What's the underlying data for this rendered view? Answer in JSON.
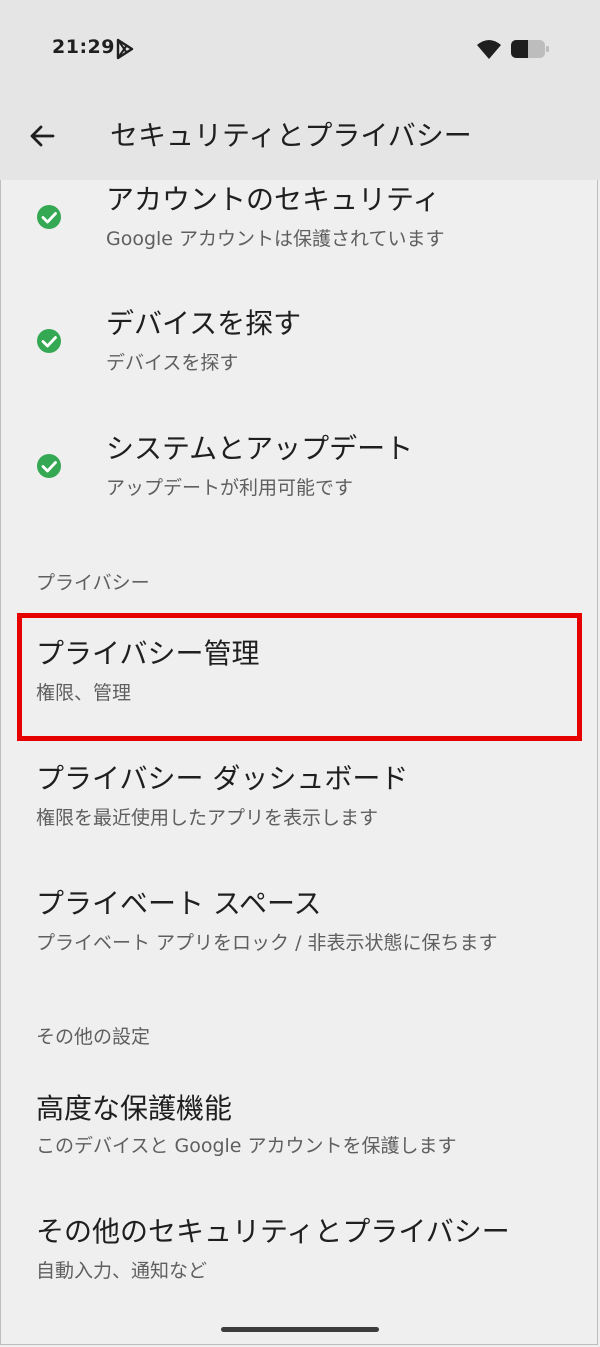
{
  "status_bar": {
    "time": "21:29"
  },
  "app_bar": {
    "title": "セキュリティとプライバシー"
  },
  "security_items": [
    {
      "title": "アカウントのセキュリティ",
      "subtitle": "Google アカウントは保護されています"
    },
    {
      "title": "デバイスを探す",
      "subtitle": "デバイスを探す"
    },
    {
      "title": "システムとアップデート",
      "subtitle": "アップデートが利用可能です"
    }
  ],
  "privacy_section": {
    "header": "プライバシー",
    "items": [
      {
        "title": "プライバシー管理",
        "subtitle": "権限、管理"
      },
      {
        "title": "プライバシー ダッシュボード",
        "subtitle": "権限を最近使用したアプリを表示します"
      },
      {
        "title": "プライベート スペース",
        "subtitle": "プライベート アプリをロック / 非表示状態に保ちます"
      }
    ]
  },
  "other_section": {
    "header": "その他の設定",
    "items": [
      {
        "title": "高度な保護機能",
        "subtitle": "このデバイスと Google アカウントを保護します"
      },
      {
        "title": "その他のセキュリティとプライバシー",
        "subtitle": "自動入力、通知など"
      }
    ]
  },
  "colors": {
    "check_green": "#34a853",
    "highlight_red": "#e60000"
  },
  "icons": [
    "play-store-icon",
    "wifi-icon",
    "battery-icon",
    "back-arrow-icon",
    "check-circle-icon"
  ]
}
